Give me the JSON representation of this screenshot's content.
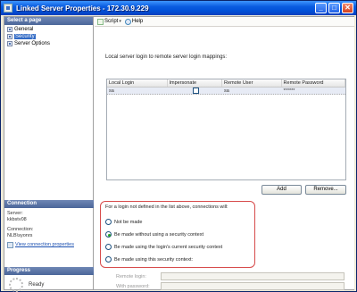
{
  "window": {
    "title": "Linked Server Properties - 172.30.9.229"
  },
  "title_buttons": {
    "minimize": "_",
    "maximize": "□",
    "close": "✕"
  },
  "left": {
    "select_page_header": "Select a page",
    "pages": [
      {
        "label": "General",
        "icon": "page-icon",
        "selected": false
      },
      {
        "label": "Security",
        "icon": "page-icon",
        "selected": true
      },
      {
        "label": "Server Options",
        "icon": "page-icon",
        "selected": false
      }
    ],
    "connection_header": "Connection",
    "server_label": "Server:",
    "server_value": "kkbstv08",
    "connection_label": "Connection:",
    "connection_value": "NLB\\syonrs",
    "view_connection_link": "View connection properties",
    "progress_header": "Progress",
    "progress_status": "Ready"
  },
  "toolbar": {
    "script_label": "Script",
    "script_caret": "▾",
    "help_label": "Help"
  },
  "security": {
    "description": "Local server login to remote server login mappings:",
    "columns": [
      "Local Login",
      "Impersonate",
      "Remote User",
      "Remote Password"
    ],
    "rows": [
      {
        "local_login": "sa",
        "impersonate": false,
        "remote_user": "sa",
        "remote_password": "******"
      }
    ],
    "add_button": "Add",
    "remove_button": "Remove...",
    "not_defined_text": "For a login not defined in the list above, connections will:",
    "options": [
      {
        "label": "Not be made",
        "checked": false
      },
      {
        "label": "Be made without using a security context",
        "checked": true
      },
      {
        "label": "Be made using the login's current security context",
        "checked": false
      },
      {
        "label": "Be made using this security context:",
        "checked": false
      }
    ],
    "remote_login_label": "Remote login:",
    "with_password_label": "With password:"
  },
  "colors": {
    "titlebar": "#0a5ce0",
    "selected": "#316ac5",
    "highlight_box": "#d74b4b"
  }
}
